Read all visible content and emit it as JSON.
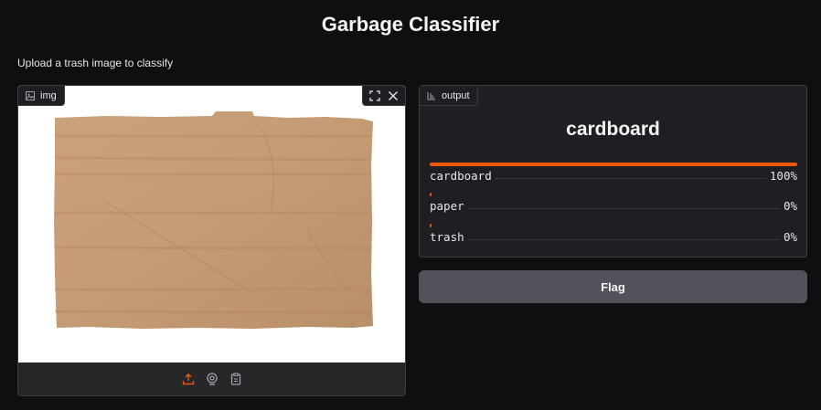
{
  "app": {
    "title": "Garbage Classifier",
    "description": "Upload a trash image to classify"
  },
  "input_panel": {
    "label": "img",
    "label_icon": "image-icon",
    "tools": [
      "fullscreen-icon",
      "close-icon"
    ],
    "sources": [
      "upload-icon",
      "webcam-icon",
      "clipboard-icon"
    ],
    "accent": "#ea580c"
  },
  "output_panel": {
    "label": "output",
    "label_icon": "label-icon",
    "prediction": "cardboard",
    "confidences": [
      {
        "label": "cardboard",
        "pct_text": "100%",
        "value": 1.0
      },
      {
        "label": "paper",
        "pct_text": "0%",
        "value": 0.0
      },
      {
        "label": "trash",
        "pct_text": "0%",
        "value": 0.0
      }
    ],
    "bar_color": "#ea580c"
  },
  "actions": {
    "flag_label": "Flag"
  }
}
